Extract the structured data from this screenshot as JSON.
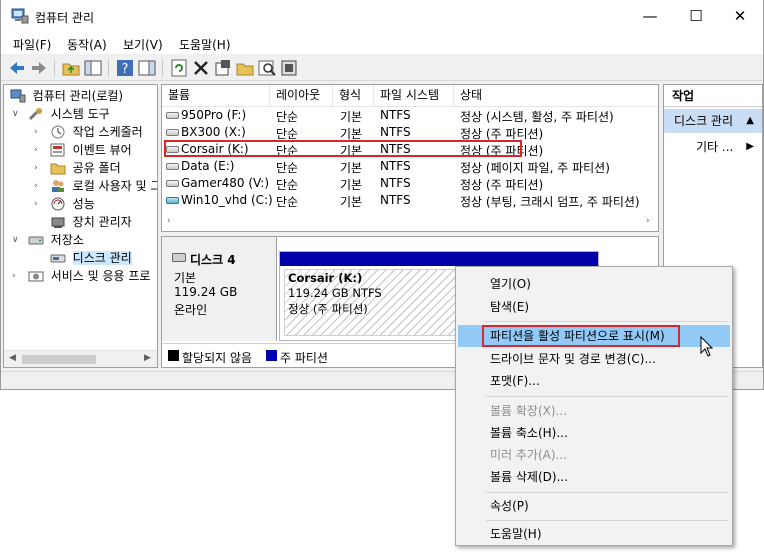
{
  "window": {
    "title": "컴퓨터 관리",
    "controls": {
      "minimize": "—",
      "maximize": "☐",
      "close": "✕"
    }
  },
  "menu": [
    "파일(F)",
    "동작(A)",
    "보기(V)",
    "도움말(H)"
  ],
  "tree": [
    {
      "label": "컴퓨터 관리(로컬)",
      "expander": "",
      "icon": "computer-icon"
    },
    {
      "label": "시스템 도구",
      "expander": "∨",
      "icon": "tools-icon"
    },
    {
      "label": "작업 스케줄러",
      "expander": "›",
      "icon": "clock-icon"
    },
    {
      "label": "이벤트 뷰어",
      "expander": "›",
      "icon": "event-viewer-icon"
    },
    {
      "label": "공유 폴더",
      "expander": "›",
      "icon": "shared-folder-icon"
    },
    {
      "label": "로컬 사용자 및 그",
      "expander": "›",
      "icon": "users-icon"
    },
    {
      "label": "성능",
      "expander": "›",
      "icon": "performance-icon"
    },
    {
      "label": "장치 관리자",
      "expander": "",
      "icon": "device-manager-icon"
    },
    {
      "label": "저장소",
      "expander": "∨",
      "icon": "storage-icon"
    },
    {
      "label": "디스크 관리",
      "expander": "",
      "icon": "disk-management-icon",
      "selected": true
    },
    {
      "label": "서비스 및 응용 프로",
      "expander": "›",
      "icon": "services-icon"
    }
  ],
  "volumes": {
    "columns": [
      "볼륨",
      "레이아웃",
      "형식",
      "파일 시스템",
      "상태"
    ],
    "rows": [
      {
        "name": "950Pro (F:)",
        "layout": "단순",
        "type": "기본",
        "fs": "NTFS",
        "status": "정상 (시스템, 활성, 주 파티션)"
      },
      {
        "name": "BX300 (X:)",
        "layout": "단순",
        "type": "기본",
        "fs": "NTFS",
        "status": "정상 (주 파티션)"
      },
      {
        "name": "Corsair (K:)",
        "layout": "단순",
        "type": "기본",
        "fs": "NTFS",
        "status": "정상 (주 파티션)"
      },
      {
        "name": "Data (E:)",
        "layout": "단순",
        "type": "기본",
        "fs": "NTFS",
        "status": "정상 (페이지 파일, 주 파티션)"
      },
      {
        "name": "Gamer480 (V:)",
        "layout": "단순",
        "type": "기본",
        "fs": "NTFS",
        "status": "정상 (주 파티션)"
      },
      {
        "name": "Win10_vhd (C:)",
        "layout": "단순",
        "type": "기본",
        "fs": "NTFS",
        "status": "정상 (부팅, 크래시 덤프, 주 파티션)"
      }
    ]
  },
  "disk": {
    "name": "디스크 4",
    "type": "기본",
    "size": "119.24 GB",
    "state": "온라인",
    "partition": {
      "label": "Corsair  (K:)",
      "size_fs": "119.24 GB NTFS",
      "status": "정상 (주 파티션)"
    }
  },
  "legend": [
    {
      "label": "할당되지 않음",
      "color": "#000000"
    },
    {
      "label": "주 파티션",
      "color": "#0000a8"
    }
  ],
  "actions": {
    "header": "작업",
    "section": "디스크 관리",
    "more": "기타 ..."
  },
  "context_menu": [
    {
      "label": "열기(O)",
      "enabled": true
    },
    {
      "label": "탐색(E)",
      "enabled": true
    },
    {
      "separator": true
    },
    {
      "label": "파티션을 활성 파티션으로 표시(M)",
      "enabled": true,
      "hover": true
    },
    {
      "label": "드라이브 문자 및 경로 변경(C)...",
      "enabled": true
    },
    {
      "label": "포맷(F)...",
      "enabled": true
    },
    {
      "separator": true
    },
    {
      "label": "볼륨 확장(X)...",
      "enabled": false
    },
    {
      "label": "볼륨 축소(H)...",
      "enabled": true
    },
    {
      "label": "미러 추가(A)...",
      "enabled": false
    },
    {
      "label": "볼륨 삭제(D)...",
      "enabled": true
    },
    {
      "separator": true
    },
    {
      "label": "속성(P)",
      "enabled": true
    },
    {
      "separator": true
    },
    {
      "label": "도움말(H)",
      "enabled": true
    }
  ],
  "colors": {
    "highlight_box": "#d9262c",
    "hover": "#91c9f7",
    "primary_partition": "#0000a8",
    "action_section": "#c9def5"
  }
}
